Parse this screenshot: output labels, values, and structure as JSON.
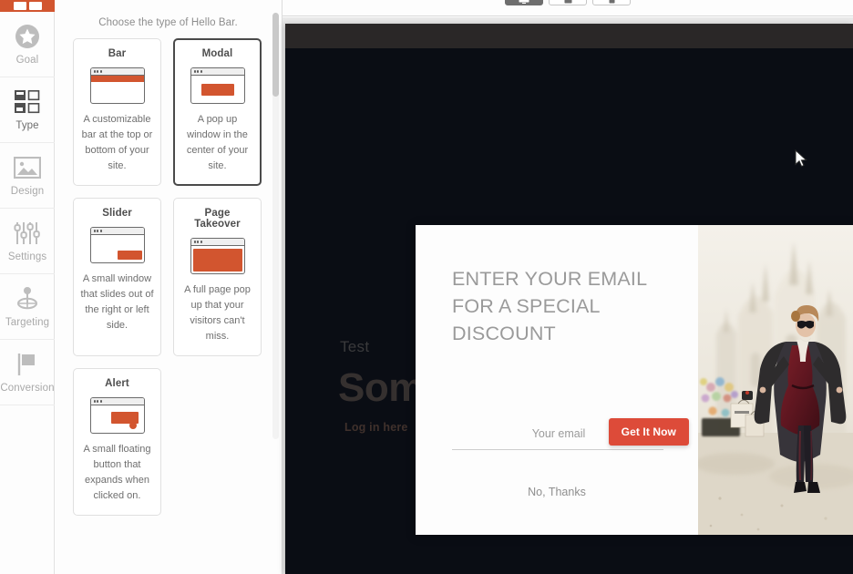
{
  "app": {
    "brand_color": "#d2552f",
    "accent_color": "#dd4b39",
    "logo_name": "hellobar-logo"
  },
  "rail": {
    "items": [
      {
        "label": "Goal",
        "icon": "star-circle-icon",
        "active": false
      },
      {
        "label": "Type",
        "icon": "layout-grid-icon",
        "active": true
      },
      {
        "label": "Design",
        "icon": "image-icon",
        "active": false
      },
      {
        "label": "Settings",
        "icon": "sliders-icon",
        "active": false
      },
      {
        "label": "Targeting",
        "icon": "target-pin-icon",
        "active": false
      },
      {
        "label": "Conversion",
        "icon": "flag-icon",
        "active": false
      }
    ]
  },
  "panel": {
    "hint": "Choose the type of Hello Bar.",
    "cards": [
      {
        "name": "Bar",
        "desc": "A customizable bar at the top or bottom of your site.",
        "selected": false,
        "mini": "m-bar"
      },
      {
        "name": "Modal",
        "desc": "A pop up window in the center of your site.",
        "selected": true,
        "mini": "m-modal"
      },
      {
        "name": "Slider",
        "desc": "A small window that slides out of the right or left side.",
        "selected": false,
        "mini": "m-slider"
      },
      {
        "name": "Page Takeover",
        "desc": "A full page pop up that your visitors can't miss.",
        "selected": false,
        "mini": "m-page"
      },
      {
        "name": "Alert",
        "desc": "A small floating button that expands when clicked on.",
        "selected": false,
        "mini": "m-alert"
      }
    ]
  },
  "topbar": {
    "devices": [
      {
        "name": "desktop-preview",
        "icon": "desktop-icon",
        "selected": true
      },
      {
        "name": "tablet-preview",
        "icon": "tablet-icon",
        "selected": false
      },
      {
        "name": "mobile-preview",
        "icon": "mobile-icon",
        "selected": false
      }
    ]
  },
  "preview": {
    "site": {
      "eyebrow": "Test",
      "headline": "Some",
      "login_link": "Log in here"
    },
    "modal": {
      "headline": "ENTER YOUR EMAIL FOR A SPECIAL DISCOUNT",
      "email_placeholder": "Your email",
      "email_value": "",
      "cta_label": "Get It Now",
      "dismiss_label": "No, Thanks",
      "image_alt": "woman-shopping-cathedral-photo"
    }
  }
}
